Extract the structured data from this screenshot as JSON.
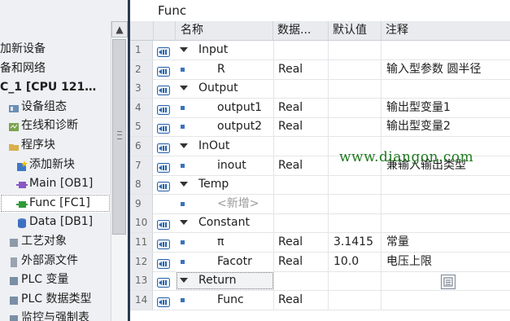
{
  "tree": {
    "items": [
      {
        "label": "加新设备",
        "icon": "none"
      },
      {
        "label": "备和网络",
        "icon": "none"
      },
      {
        "label": "C_1 [CPU 121…",
        "icon": "none"
      },
      {
        "label": "设备组态",
        "icon": "device-config-icon"
      },
      {
        "label": "在线和诊断",
        "icon": "online-diagnostics-icon"
      },
      {
        "label": "程序块",
        "icon": "program-blocks-folder-icon"
      },
      {
        "label": "添加新块",
        "icon": "add-new-block-icon"
      },
      {
        "label": "Main [OB1]",
        "icon": "ob-block-icon"
      },
      {
        "label": "Func [FC1]",
        "icon": "fc-block-icon",
        "selected": true
      },
      {
        "label": "Data [DB1]",
        "icon": "db-block-icon"
      },
      {
        "label": "工艺对象",
        "icon": "technology-objects-icon"
      },
      {
        "label": "外部源文件",
        "icon": "external-source-icon"
      },
      {
        "label": "PLC 变量",
        "icon": "plc-tags-icon"
      },
      {
        "label": "PLC 数据类型",
        "icon": "plc-data-types-icon"
      },
      {
        "label": "监控与强制表",
        "icon": "watch-force-tables-icon"
      }
    ]
  },
  "editor": {
    "block_title": "Func",
    "columns": {
      "name": "名称",
      "datatype": "数据...",
      "default": "默认值",
      "comment": "注释"
    },
    "rows": [
      {
        "num": "1",
        "kind": "group",
        "name": "Input",
        "type": "",
        "default": "",
        "comment": ""
      },
      {
        "num": "2",
        "kind": "var",
        "name": "R",
        "type": "Real",
        "default": "",
        "comment": "输入型参数 圆半径"
      },
      {
        "num": "3",
        "kind": "group",
        "name": "Output",
        "type": "",
        "default": "",
        "comment": ""
      },
      {
        "num": "4",
        "kind": "var",
        "name": "output1",
        "type": "Real",
        "default": "",
        "comment": "输出型变量1"
      },
      {
        "num": "5",
        "kind": "var",
        "name": "output2",
        "type": "Real",
        "default": "",
        "comment": "输出型变量2"
      },
      {
        "num": "6",
        "kind": "group",
        "name": "InOut",
        "type": "",
        "default": "",
        "comment": ""
      },
      {
        "num": "7",
        "kind": "var",
        "name": "inout",
        "type": "Real",
        "default": "",
        "comment": "兼输入输出类型"
      },
      {
        "num": "8",
        "kind": "group",
        "name": "Temp",
        "type": "",
        "default": "",
        "comment": ""
      },
      {
        "num": "9",
        "kind": "new",
        "name": "<新增>",
        "type": "",
        "default": "",
        "comment": ""
      },
      {
        "num": "10",
        "kind": "group",
        "name": "Constant",
        "type": "",
        "default": "",
        "comment": ""
      },
      {
        "num": "11",
        "kind": "var",
        "name": "π",
        "type": "Real",
        "default": "3.1415",
        "comment": "常量"
      },
      {
        "num": "12",
        "kind": "var",
        "name": "Facotr",
        "type": "Real",
        "default": "10.0",
        "comment": "电压上限"
      },
      {
        "num": "13",
        "kind": "group",
        "name": "Return",
        "type": "",
        "default": "",
        "comment": "",
        "selected": true
      },
      {
        "num": "14",
        "kind": "var",
        "name": "Func",
        "type": "Real",
        "default": "",
        "comment": ""
      }
    ]
  },
  "watermark": "www.diangon.com",
  "colors": {
    "accent": "#3b73b9",
    "divider": "#2a3a4e",
    "watermark": "#1f7a1f"
  }
}
